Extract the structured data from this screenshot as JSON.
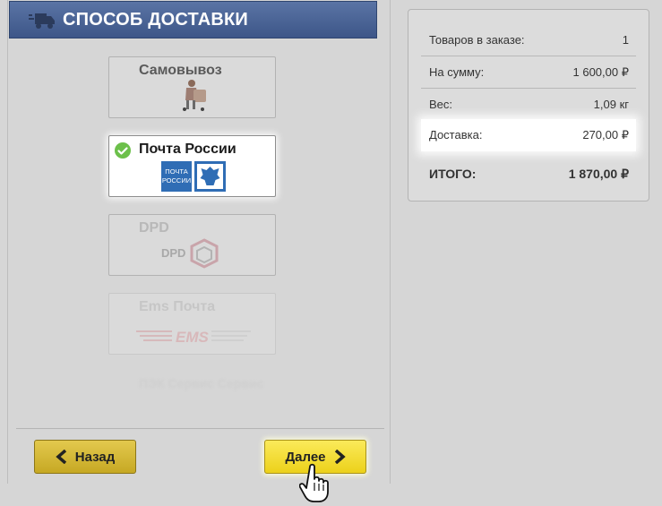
{
  "header": {
    "title": "СПОСОБ ДОСТАВКИ",
    "icon": "truck-icon"
  },
  "delivery_methods": [
    {
      "label": "Самовывоз",
      "icon": "courier-icon",
      "selected": false
    },
    {
      "label": "Почта России",
      "icon": "russian-post-logo",
      "logo_text_1": "ПОЧТА",
      "logo_text_2": "РОССИИ",
      "selected": true
    },
    {
      "label": "DPD",
      "icon": "dpd-logo",
      "logo_text": "DPD",
      "selected": false
    },
    {
      "label": "Ems Почта",
      "icon": "ems-logo",
      "logo_text": "EMS",
      "selected": false
    },
    {
      "label": "ПЭК Сервис Сервис"
    }
  ],
  "buttons": {
    "back": "Назад",
    "next": "Далее"
  },
  "summary": {
    "items_label": "Товаров в заказе:",
    "items_value": "1",
    "sum_label": "На сумму:",
    "sum_value": "1 600,00 ₽",
    "weight_label": "Вес:",
    "weight_value": "1,09 кг",
    "delivery_label": "Доставка:",
    "delivery_value": "270,00 ₽",
    "total_label": "ИТОГО:",
    "total_value": "1 870,00 ₽"
  },
  "colors": {
    "header": "#3d5688",
    "button_yellow": "#ecd11a",
    "check_green": "#6cc04a"
  }
}
